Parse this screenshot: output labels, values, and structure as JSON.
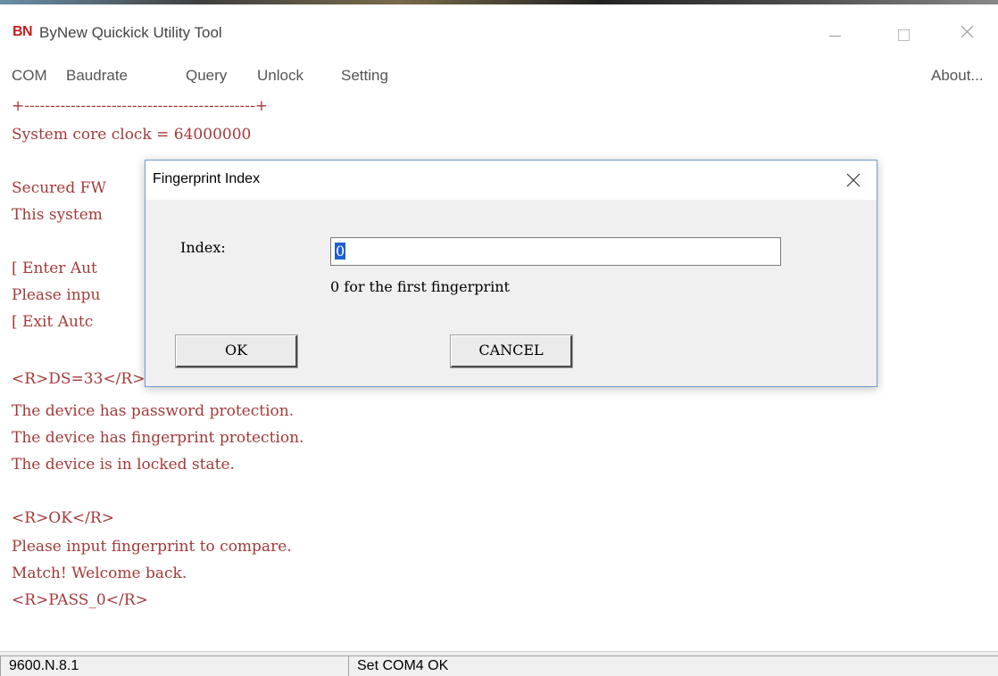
{
  "window": {
    "logo": "BN",
    "title": "ByNew Quickick Utility Tool"
  },
  "menu": {
    "items": [
      "COM",
      "Baudrate",
      "Query",
      "Unlock",
      "Setting"
    ],
    "about": "About..."
  },
  "console": {
    "lines": [
      "+---------------------------------------------+",
      "System core clock = 64000000",
      "",
      "Secured FW",
      "This system",
      "",
      "[ Enter Aut",
      "Please inpu",
      "[ Exit Autc",
      "",
      "<R>DS=33</R>",
      "The device has password protection.",
      "The device has fingerprint protection.",
      "The device is in locked state.",
      "",
      "<R>OK</R>",
      "Please input fingerprint to compare.",
      "Match! Welcome back.",
      "<R>PASS_0</R>"
    ]
  },
  "dialog": {
    "title": "Fingerprint Index",
    "label": "Index:",
    "value": "0",
    "hint": "0 for the first fingerprint",
    "ok_label": "OK",
    "cancel_label": "CANCEL"
  },
  "status": {
    "left": "9600.N.8.1",
    "right": "Set COM4 OK"
  },
  "colors": {
    "console_text": "#a33a3a",
    "logo": "#c81e1e",
    "selection": "#1e5fd6"
  },
  "icons": [
    "minimize-icon",
    "maximize-icon",
    "close-icon",
    "dialog-close-icon"
  ]
}
